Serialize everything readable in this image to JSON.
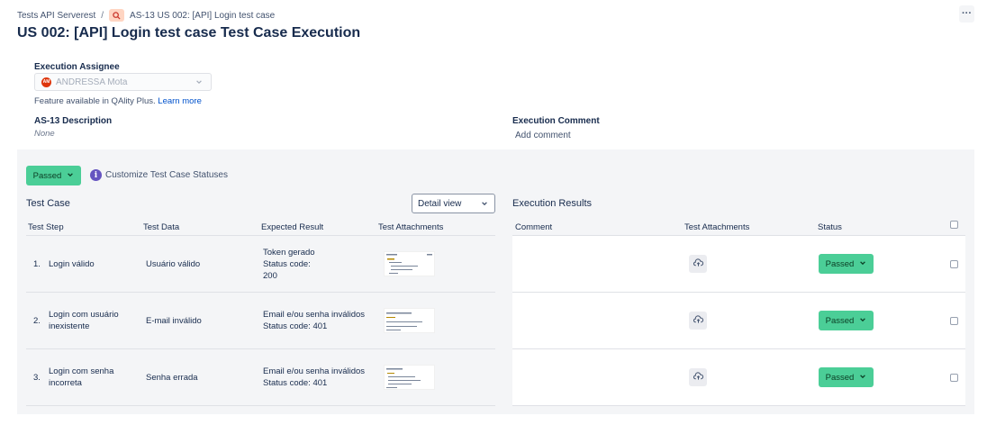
{
  "breadcrumb": {
    "project": "Tests API Serverest",
    "separator": "/",
    "issue": "AS-13 US 002: [API] Login test case"
  },
  "more_label": "···",
  "title": "US 002: [API] Login test case Test Case Execution",
  "assignee": {
    "label": "Execution Assignee",
    "avatar_initials": "AM",
    "avatar_color": "#de350b",
    "value": "ANDRESSA Mota",
    "feature_note": "Feature available in QAlity Plus.",
    "learn_more": "Learn more"
  },
  "description": {
    "label": "AS-13 Description",
    "value": "None"
  },
  "comment": {
    "label": "Execution Comment",
    "placeholder": "Add comment"
  },
  "execution_status": "Passed",
  "customize_link": "Customize Test Case Statuses",
  "test_case": {
    "title": "Test Case",
    "view": "Detail view",
    "headers": [
      "Test Step",
      "Test Data",
      "Expected Result",
      "Test Attachments"
    ],
    "rows": [
      {
        "num": "1.",
        "step": [
          "Login válido"
        ],
        "data": "Usuário válido",
        "expected": [
          "Token gerado",
          "Status code:",
          "200"
        ]
      },
      {
        "num": "2.",
        "step": [
          "Login com usuário",
          "inexistente"
        ],
        "data": "E-mail inválido",
        "expected": [
          "Email e/ou senha inválidos",
          "Status code: 401"
        ]
      },
      {
        "num": "3.",
        "step": [
          "Login com senha",
          "incorreta"
        ],
        "data": "Senha errada",
        "expected": [
          "Email e/ou senha inválidos",
          "Status code: 401"
        ]
      }
    ]
  },
  "execution_results": {
    "title": "Execution Results",
    "headers": [
      "Comment",
      "Test Attachments",
      "Status"
    ],
    "rows": [
      {
        "status": "Passed"
      },
      {
        "status": "Passed"
      },
      {
        "status": "Passed"
      }
    ]
  },
  "colors": {
    "passed": "#4bce97",
    "link": "#0052cc",
    "info": "#6554c0",
    "issue_icon_bg": "#ffd5c2"
  }
}
